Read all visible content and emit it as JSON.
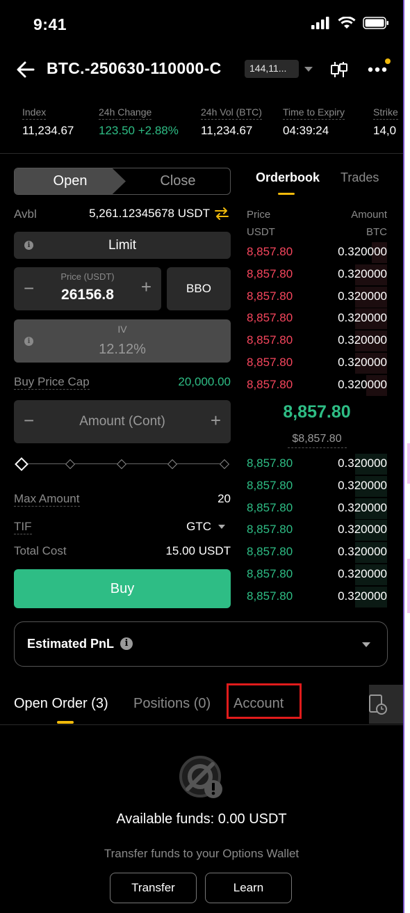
{
  "status_bar": {
    "time": "9:41"
  },
  "header": {
    "symbol": "BTC.-250630-110000-C",
    "price_chip": "144,11...",
    "icons": [
      "back-arrow-icon",
      "candlestick-icon",
      "more-icon"
    ]
  },
  "stats": [
    {
      "label": "Index",
      "value": "11,234.67"
    },
    {
      "label": "24h Change",
      "value": "123.50 +2.88%"
    },
    {
      "label": "24h Vol (BTC)",
      "value": "11,234.67"
    },
    {
      "label": "Time to Expiry",
      "value": "04:39:24"
    },
    {
      "label": "Strike",
      "value": "14,0"
    }
  ],
  "order_form": {
    "open_label": "Open",
    "close_label": "Close",
    "avbl_label": "Avbl",
    "avbl_value": "5,261.12345678 USDT",
    "order_type": "Limit",
    "price_label": "Price (USDT)",
    "price_value": "26156.8",
    "bbo_label": "BBO",
    "iv_label": "IV",
    "iv_value": "12.12%",
    "buy_price_cap_label": "Buy Price Cap",
    "buy_price_cap_value": "20,000.00",
    "amount_placeholder": "Amount (Cont)",
    "max_amount_label": "Max Amount",
    "max_amount_value": "20",
    "tif_label": "TIF",
    "tif_value": "GTC",
    "total_cost_label": "Total Cost",
    "total_cost_value": "15.00 USDT",
    "buy_label": "Buy"
  },
  "orderbook": {
    "tab_active": "Orderbook",
    "tab_other": "Trades",
    "price_header": "Price",
    "price_unit": "USDT",
    "amount_header": "Amount",
    "amount_unit": "BTC",
    "asks": [
      {
        "price": "8,857.80",
        "amount": "0.320000"
      },
      {
        "price": "8,857.80",
        "amount": "0.320000"
      },
      {
        "price": "8,857.80",
        "amount": "0.320000"
      },
      {
        "price": "8,857.80",
        "amount": "0.320000"
      },
      {
        "price": "8,857.80",
        "amount": "0.320000"
      },
      {
        "price": "8,857.80",
        "amount": "0.320000"
      },
      {
        "price": "8,857.80",
        "amount": "0.320000"
      }
    ],
    "mid_price": "8,857.80",
    "mark_price": "$8,857.80",
    "bids": [
      {
        "price": "8,857.80",
        "amount": "0.320000"
      },
      {
        "price": "8,857.80",
        "amount": "0.320000"
      },
      {
        "price": "8,857.80",
        "amount": "0.320000"
      },
      {
        "price": "8,857.80",
        "amount": "0.320000"
      },
      {
        "price": "8,857.80",
        "amount": "0.320000"
      },
      {
        "price": "8,857.80",
        "amount": "0.320000"
      },
      {
        "price": "8,857.80",
        "amount": "0.320000"
      }
    ]
  },
  "pnl": {
    "label": "Estimated PnL"
  },
  "bottom_tabs": {
    "open_order": "Open Order (3)",
    "positions": "Positions (0)",
    "account": "Account"
  },
  "empty_state": {
    "funds": "Available funds: 0.00 USDT",
    "message": "Transfer funds to your Options Wallet",
    "transfer_label": "Transfer",
    "learn_label": "Learn"
  },
  "colors": {
    "green": "#2ebd85",
    "red": "#f6465d",
    "accent": "#f0b90b",
    "highlight": "#e01b1b"
  }
}
